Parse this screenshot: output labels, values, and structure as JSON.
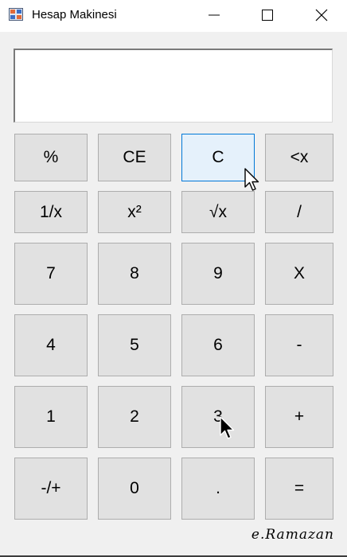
{
  "window": {
    "title": "Hesap Makinesi",
    "icon": "calculator-app-icon",
    "controls": [
      "minimize-icon",
      "maximize-icon",
      "close-icon"
    ]
  },
  "display": {
    "value": ""
  },
  "keypad": {
    "percent": "%",
    "clear_entry": "CE",
    "clear": "C",
    "backspace": "<x",
    "reciprocal": "1/x",
    "square": "x²",
    "sqrt": "√x",
    "divide": "/",
    "seven": "7",
    "eight": "8",
    "nine": "9",
    "multiply": "X",
    "four": "4",
    "five": "5",
    "six": "6",
    "minus": "-",
    "one": "1",
    "two": "2",
    "three": "3",
    "plus": "+",
    "negate": "-/+",
    "zero": "0",
    "decimal": ".",
    "equals": "="
  },
  "state": {
    "hovered_key": "clear"
  },
  "colors": {
    "button_face": "#e1e1e1",
    "button_border": "#adadad",
    "hover_face": "#e5f1fb",
    "hover_border": "#0078d7",
    "window_bg": "#f0f0f0"
  },
  "signature": "e.Ramazan"
}
